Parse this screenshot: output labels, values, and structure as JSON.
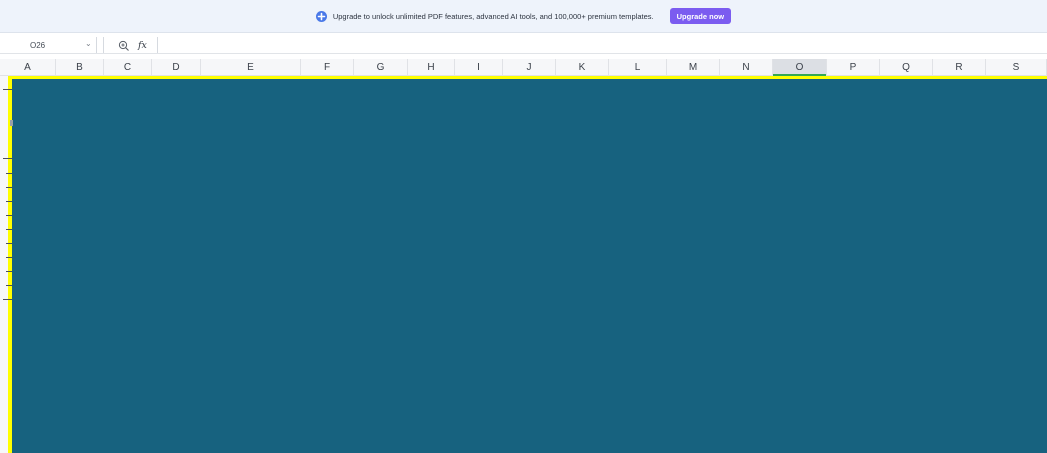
{
  "banner": {
    "text": "Upgrade to unlock unlimited PDF features, advanced AI tools, and 100,000+ premium templates.",
    "button_label": "Upgrade now",
    "icon": "upgrade-shield-icon",
    "button_color": "#7b5cf0"
  },
  "formula_bar": {
    "name_box_value": "O26",
    "formula_value": "",
    "zoom_icon": "zoom-icon",
    "fx_label": "fx"
  },
  "columns": [
    "A",
    "B",
    "C",
    "D",
    "E",
    "F",
    "G",
    "H",
    "I",
    "J",
    "K",
    "L",
    "M",
    "N",
    "O",
    "P",
    "Q",
    "R",
    "S"
  ],
  "selected_column": "O",
  "colors": {
    "fill": "#17627f",
    "border": "#ffff00",
    "selection": "#34a853"
  }
}
